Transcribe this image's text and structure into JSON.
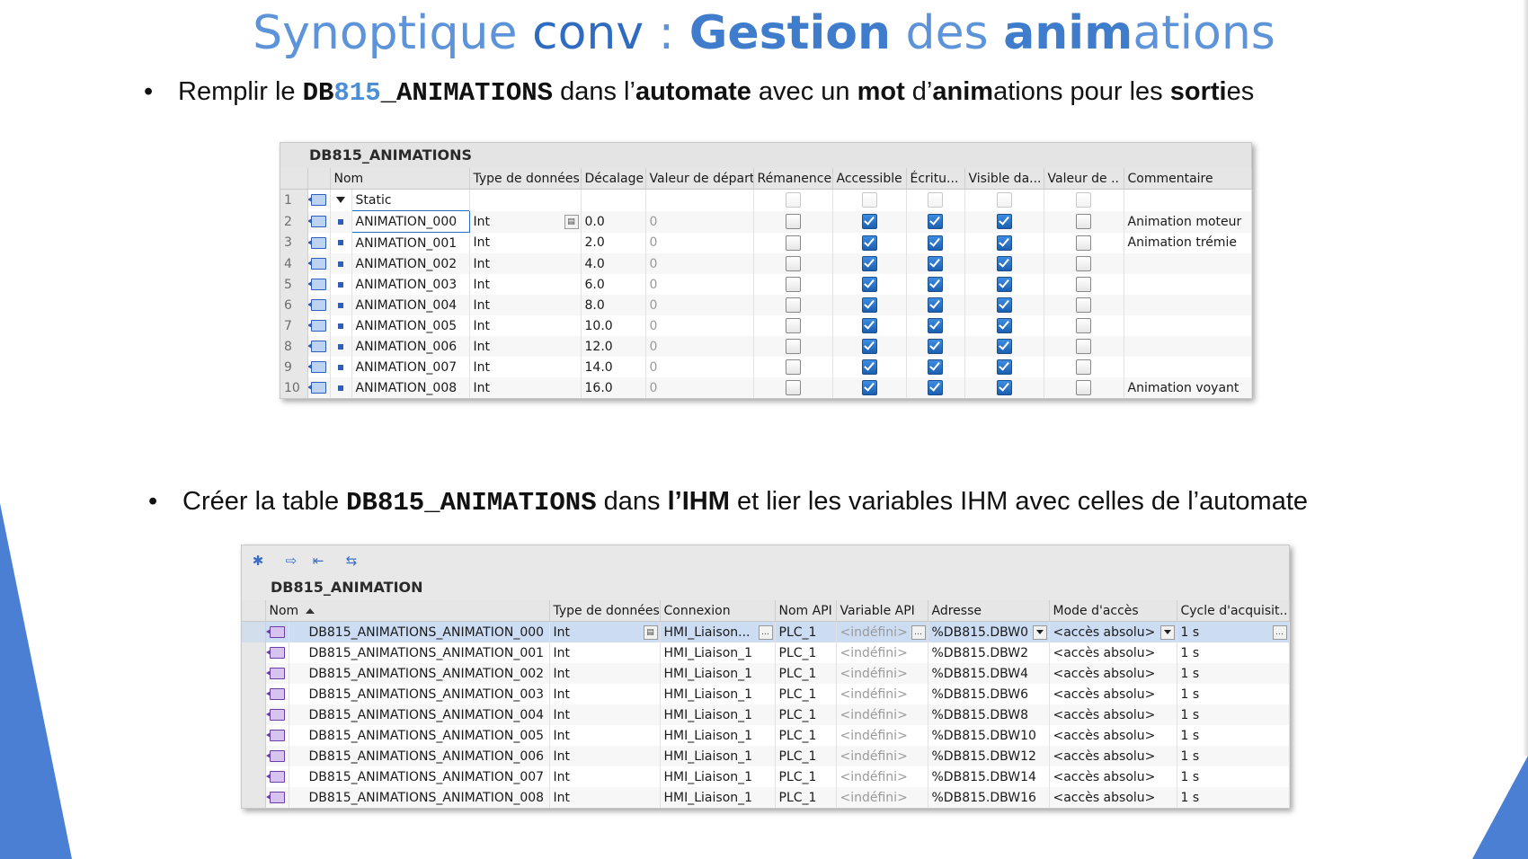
{
  "slide": {
    "title": {
      "part1": "Synoptique ",
      "part2": "conv",
      "part3": " : ",
      "part4": "Gestion",
      "part5": " des ",
      "part6": "anim",
      "part7": "ations"
    },
    "bullet1": {
      "t1": "Remplir le ",
      "mono1": "DB",
      "mono2": "815",
      "mono3": "_ANIMATIONS",
      "t2": "  dans l’",
      "b1": "automate",
      "t3": " avec un ",
      "b2": "mot",
      "t4": " d’",
      "b3": "anim",
      "t5": "ations pour les ",
      "b4": "sorti",
      "t6": "es"
    },
    "bullet2": {
      "t1": "Créer la table ",
      "mono1": "DB815_ANIMATIONS",
      "t2": " dans ",
      "b1": "l’IHM",
      "t3": " et lier les variables IHM avec celles de l’automate"
    }
  },
  "plc_table": {
    "title": "DB815_ANIMATIONS",
    "headers": [
      "Nom",
      "Type de données",
      "Décalage",
      "Valeur de départ",
      "Rémanence",
      "Accessible",
      "Écritu...",
      "Visible da...",
      "Valeur de ..",
      "Commentaire"
    ],
    "static_row": {
      "num": "1",
      "name": "Static"
    },
    "rows": [
      {
        "num": "2",
        "name": "ANIMATION_000",
        "type": "Int",
        "offset": "0.0",
        "start": "0",
        "comment": "Animation moteur"
      },
      {
        "num": "3",
        "name": "ANIMATION_001",
        "type": "Int",
        "offset": "2.0",
        "start": "0",
        "comment": "Animation trémie"
      },
      {
        "num": "4",
        "name": "ANIMATION_002",
        "type": "Int",
        "offset": "4.0",
        "start": "0",
        "comment": ""
      },
      {
        "num": "5",
        "name": "ANIMATION_003",
        "type": "Int",
        "offset": "6.0",
        "start": "0",
        "comment": ""
      },
      {
        "num": "6",
        "name": "ANIMATION_004",
        "type": "Int",
        "offset": "8.0",
        "start": "0",
        "comment": ""
      },
      {
        "num": "7",
        "name": "ANIMATION_005",
        "type": "Int",
        "offset": "10.0",
        "start": "0",
        "comment": ""
      },
      {
        "num": "8",
        "name": "ANIMATION_006",
        "type": "Int",
        "offset": "12.0",
        "start": "0",
        "comment": ""
      },
      {
        "num": "9",
        "name": "ANIMATION_007",
        "type": "Int",
        "offset": "14.0",
        "start": "0",
        "comment": ""
      },
      {
        "num": "10",
        "name": "ANIMATION_008",
        "type": "Int",
        "offset": "16.0",
        "start": "0",
        "comment": "Animation voyant"
      }
    ]
  },
  "hmi_table": {
    "title": "DB815_ANIMATION",
    "headers": [
      "Nom",
      "Type de données",
      "Connexion",
      "Nom API",
      "Variable API",
      "Adresse",
      "Mode d'accès",
      "Cycle d'acquisit.."
    ],
    "rows": [
      {
        "name": "DB815_ANIMATIONS_ANIMATION_000",
        "type": "Int",
        "conn": "HMI_Liaison...",
        "api": "PLC_1",
        "var": "<indéfini>",
        "addr": "%DB815.DBW0",
        "mode": "<accès absolu>",
        "cycle": "1 s"
      },
      {
        "name": "DB815_ANIMATIONS_ANIMATION_001",
        "type": "Int",
        "conn": "HMI_Liaison_1",
        "api": "PLC_1",
        "var": "<indéfini>",
        "addr": "%DB815.DBW2",
        "mode": "<accès absolu>",
        "cycle": "1 s"
      },
      {
        "name": "DB815_ANIMATIONS_ANIMATION_002",
        "type": "Int",
        "conn": "HMI_Liaison_1",
        "api": "PLC_1",
        "var": "<indéfini>",
        "addr": "%DB815.DBW4",
        "mode": "<accès absolu>",
        "cycle": "1 s"
      },
      {
        "name": "DB815_ANIMATIONS_ANIMATION_003",
        "type": "Int",
        "conn": "HMI_Liaison_1",
        "api": "PLC_1",
        "var": "<indéfini>",
        "addr": "%DB815.DBW6",
        "mode": "<accès absolu>",
        "cycle": "1 s"
      },
      {
        "name": "DB815_ANIMATIONS_ANIMATION_004",
        "type": "Int",
        "conn": "HMI_Liaison_1",
        "api": "PLC_1",
        "var": "<indéfini>",
        "addr": "%DB815.DBW8",
        "mode": "<accès absolu>",
        "cycle": "1 s"
      },
      {
        "name": "DB815_ANIMATIONS_ANIMATION_005",
        "type": "Int",
        "conn": "HMI_Liaison_1",
        "api": "PLC_1",
        "var": "<indéfini>",
        "addr": "%DB815.DBW10",
        "mode": "<accès absolu>",
        "cycle": "1 s"
      },
      {
        "name": "DB815_ANIMATIONS_ANIMATION_006",
        "type": "Int",
        "conn": "HMI_Liaison_1",
        "api": "PLC_1",
        "var": "<indéfini>",
        "addr": "%DB815.DBW12",
        "mode": "<accès absolu>",
        "cycle": "1 s"
      },
      {
        "name": "DB815_ANIMATIONS_ANIMATION_007",
        "type": "Int",
        "conn": "HMI_Liaison_1",
        "api": "PLC_1",
        "var": "<indéfini>",
        "addr": "%DB815.DBW14",
        "mode": "<accès absolu>",
        "cycle": "1 s"
      },
      {
        "name": "DB815_ANIMATIONS_ANIMATION_008",
        "type": "Int",
        "conn": "HMI_Liaison_1",
        "api": "PLC_1",
        "var": "<indéfini>",
        "addr": "%DB815.DBW16",
        "mode": "<accès absolu>",
        "cycle": "1 s"
      }
    ]
  },
  "icons": {
    "toolbar": [
      "add-tag-icon",
      "export-icon",
      "import-icon",
      "link-tags-icon"
    ],
    "row": "db-tag-icon"
  },
  "colors": {
    "accent": "#4a7fd4",
    "title": "#5d93d8",
    "selection": "#ccdcf3",
    "checkbox_on": "#1c5fb0"
  }
}
